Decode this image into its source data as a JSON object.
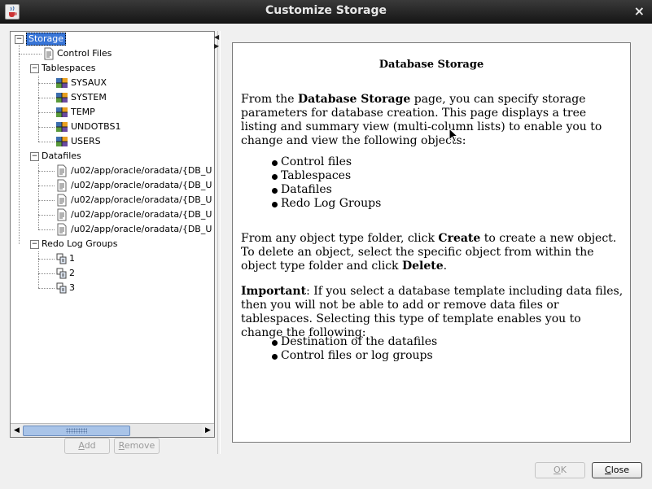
{
  "window": {
    "title": "Customize Storage",
    "close_glyph": "×"
  },
  "tree": {
    "root": {
      "label": "Storage",
      "toggle": "−"
    },
    "control_files": {
      "label": "Control Files"
    },
    "tablespaces": {
      "label": "Tablespaces",
      "toggle": "−",
      "items": [
        "SYSAUX",
        "SYSTEM",
        "TEMP",
        "UNDOTBS1",
        "USERS"
      ]
    },
    "datafiles": {
      "label": "Datafiles",
      "toggle": "−",
      "items": [
        "/u02/app/oracle/oradata/{DB_U",
        "/u02/app/oracle/oradata/{DB_U",
        "/u02/app/oracle/oradata/{DB_U",
        "/u02/app/oracle/oradata/{DB_U",
        "/u02/app/oracle/oradata/{DB_U"
      ]
    },
    "redo_log_groups": {
      "label": "Redo Log Groups",
      "toggle": "−",
      "items": [
        "1",
        "2",
        "3"
      ]
    }
  },
  "scrollbar": {
    "left_arrow": "◀",
    "right_arrow": "▶"
  },
  "buttons": {
    "add": {
      "mnemonic": "A",
      "rest": "dd"
    },
    "remove": {
      "mnemonic": "R",
      "rest": "emove"
    },
    "ok": {
      "mnemonic": "O",
      "rest": "K"
    },
    "close": {
      "mnemonic": "C",
      "rest": "lose"
    }
  },
  "splitter": {
    "left": "◀",
    "right": "▶"
  },
  "help": {
    "title": "Database Storage",
    "p1": {
      "a": "From the ",
      "b": "Database Storage",
      "c": " page, you can specify storage parameters for database creation. This page displays a tree listing and summary view (multi-column lists) to enable you to change and view the following objects:"
    },
    "list1": [
      "Control files",
      "Tablespaces",
      "Datafiles",
      "Redo Log Groups"
    ],
    "p2": {
      "a": "From any object type folder, click ",
      "b": "Create",
      "c": " to create a new object. To delete an object, select the specific object from within the object type folder and click ",
      "d": "Delete",
      "e": "."
    },
    "p3": {
      "a": "Important",
      "b": ": If you select a database template including data files, then you will not be able to add or remove data files or tablespaces. Selecting this type of template enables you to change the following:"
    },
    "list2": [
      "Destination of the datafiles",
      "Control files or log groups"
    ]
  },
  "icons": {
    "app": "java-cup-icon",
    "control_files": "document-icon",
    "tablespace": "tablespace-icon",
    "datafile": "document-icon",
    "redo_log": "log-group-icon"
  }
}
